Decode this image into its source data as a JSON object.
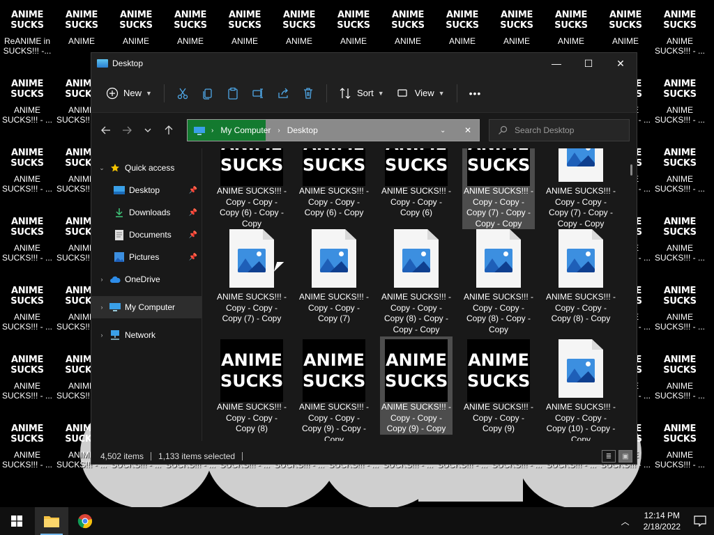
{
  "desktop": {
    "icon_thumb_text": "ANIME\nSUCKS",
    "col0_row0_label": "ReANIME in SUCKS!!! -...",
    "col_label_short": "ANIME",
    "col_label_long": "ANIME SUCKS!!! - ...",
    "cut_label": "SUCKS!!! - ...",
    "logo_text": "SUCKS"
  },
  "window": {
    "title": "Desktop",
    "controls": {
      "minimize": "—",
      "maximize": "☐",
      "close": "✕"
    }
  },
  "toolbar": {
    "new_label": "New",
    "sort_label": "Sort",
    "view_label": "View",
    "more_label": "•••"
  },
  "address": {
    "crumbs": [
      "My Computer",
      "Desktop"
    ],
    "search_placeholder": "Search Desktop"
  },
  "nav": {
    "quick_access": "Quick access",
    "desktop": "Desktop",
    "downloads": "Downloads",
    "documents": "Documents",
    "pictures": "Pictures",
    "onedrive": "OneDrive",
    "my_computer": "My Computer",
    "network": "Network"
  },
  "files": {
    "r0": [
      "ANIME SUCKS!!! - Copy - Copy - Copy (6) - Copy - Copy",
      "ANIME SUCKS!!! - Copy - Copy - Copy (6) - Copy",
      "ANIME SUCKS!!! - Copy - Copy - Copy (6)",
      "ANIME SUCKS!!! - Copy - Copy - Copy (7) - Copy - Copy - Copy",
      "ANIME SUCKS!!! - Copy - Copy - Copy (7) - Copy - Copy - Copy"
    ],
    "r1": [
      "ANIME SUCKS!!! - Copy - Copy - Copy (7) - Copy",
      "ANIME SUCKS!!! - Copy - Copy - Copy (7)",
      "ANIME SUCKS!!! - Copy - Copy - Copy (8) - Copy - Copy - Copy",
      "ANIME SUCKS!!! - Copy - Copy - Copy (8) - Copy - Copy",
      "ANIME SUCKS!!! - Copy - Copy - Copy (8) - Copy"
    ],
    "r2": [
      "ANIME SUCKS!!! - Copy - Copy - Copy (8)",
      "ANIME SUCKS!!! - Copy - Copy - Copy (9) - Copy - Copy",
      "ANIME SUCKS!!! - Copy - Copy - Copy (9) - Copy",
      "ANIME SUCKS!!! - Copy - Copy - Copy (9)",
      "ANIME SUCKS!!! - Copy - Copy - Copy (10) - Copy - Copy"
    ],
    "thumb_word1": "ANIME",
    "thumb_word2": "SUCKS"
  },
  "status": {
    "items": "4,502 items",
    "selected": "1,133 items selected"
  },
  "taskbar": {
    "time": "12:14 PM",
    "date": "2/18/2022"
  }
}
